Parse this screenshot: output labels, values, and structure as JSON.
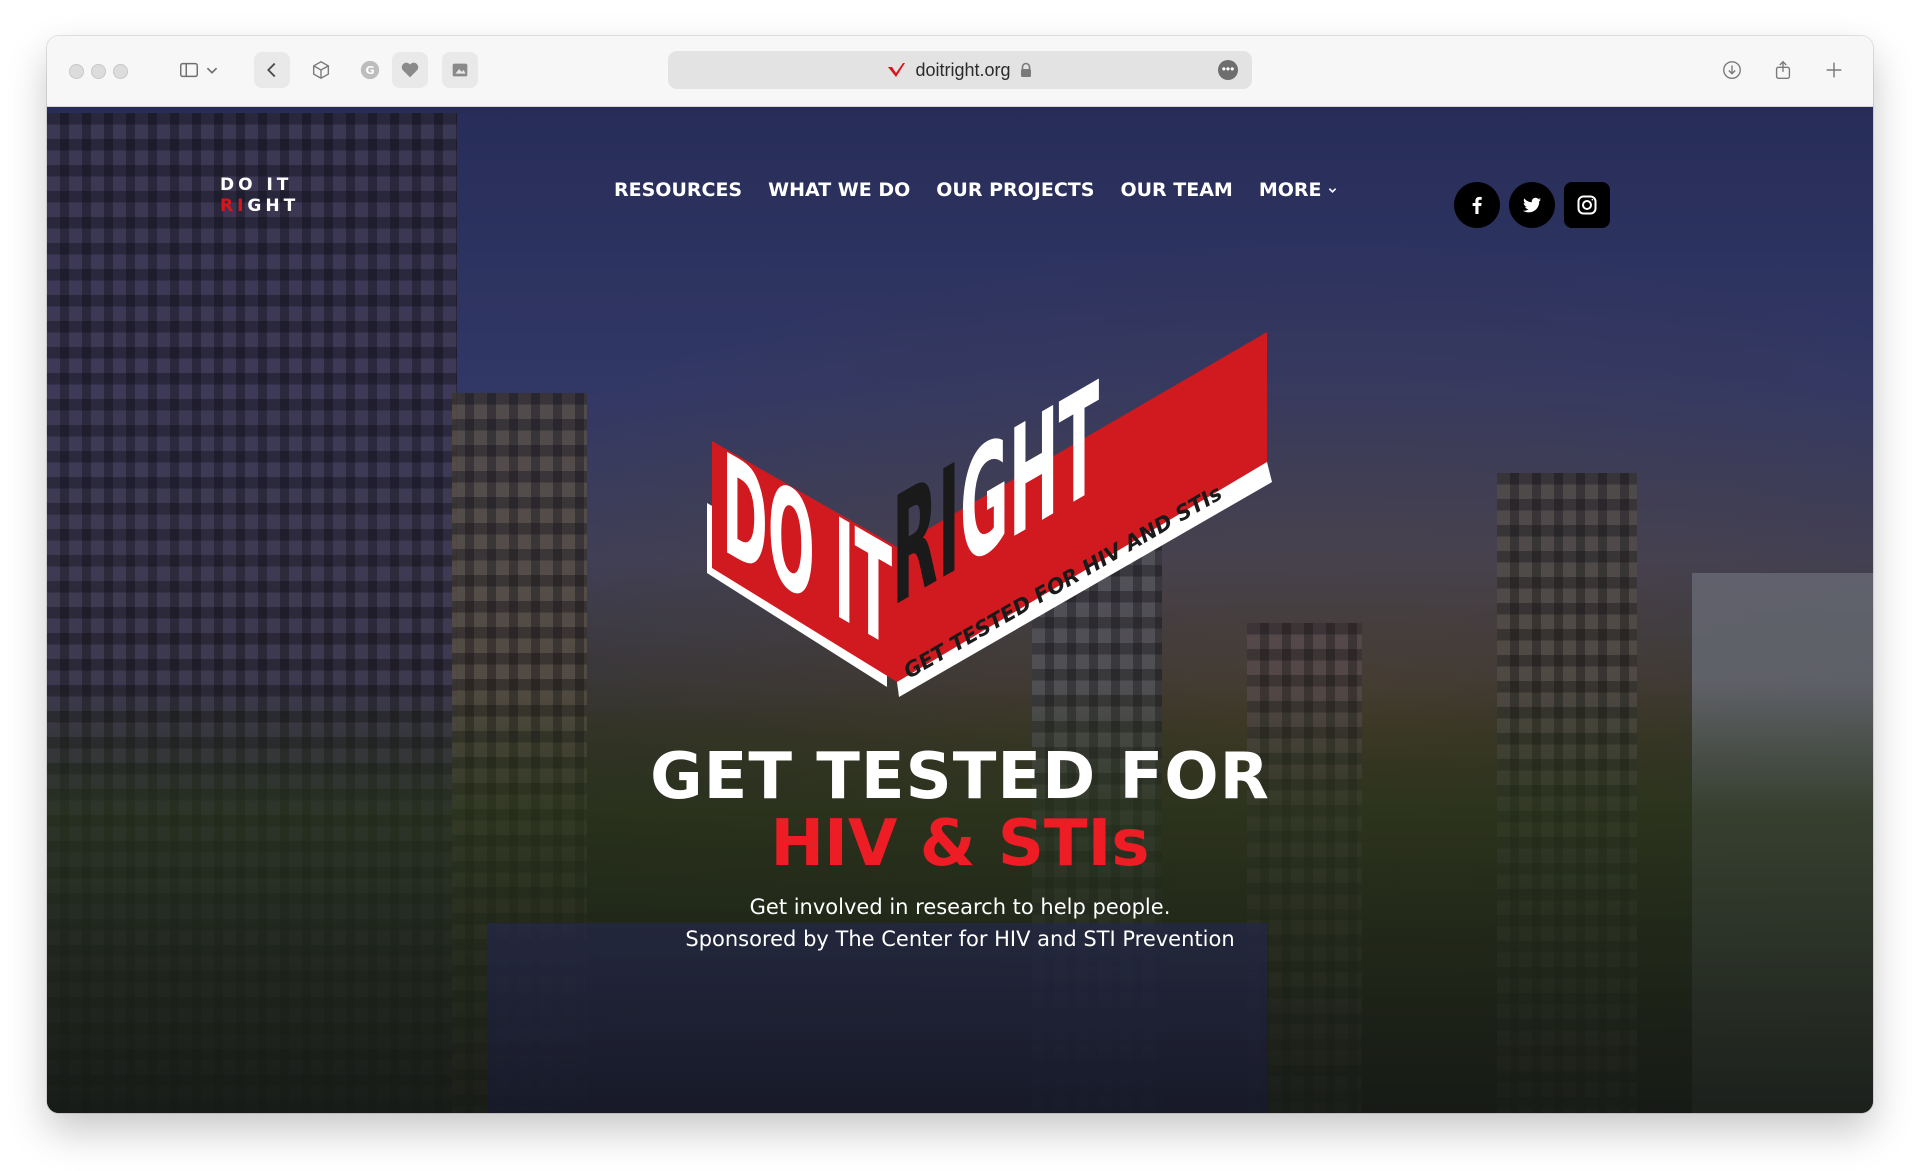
{
  "browser": {
    "url": "doitright.org",
    "more_label": "•••"
  },
  "site": {
    "logo_line1": "DO IT",
    "logo_line2_red": "RI",
    "logo_line2_white": "GHT",
    "nav": [
      {
        "label": "RESOURCES"
      },
      {
        "label": "WHAT WE DO"
      },
      {
        "label": "OUR PROJECTS"
      },
      {
        "label": "OUR TEAM"
      },
      {
        "label": "MORE"
      }
    ],
    "social": [
      "facebook-icon",
      "twitter-icon",
      "instagram-icon"
    ]
  },
  "hero": {
    "logo_text_do_it": "DO IT",
    "logo_text_ri": "RI",
    "logo_text_ght": "GHT",
    "logo_tagline": "GET TESTED FOR HIV AND STIs",
    "headline_line1": "GET TESTED FOR",
    "headline_line2": "HIV & STIs",
    "subtitle_line1": "Get involved in research to help people.",
    "subtitle_line2": "Sponsored by The Center for HIV and STI Prevention"
  },
  "colors": {
    "brand_red": "#ee1c24",
    "logo_red": "#d01a1f",
    "text_white": "#ffffff"
  }
}
